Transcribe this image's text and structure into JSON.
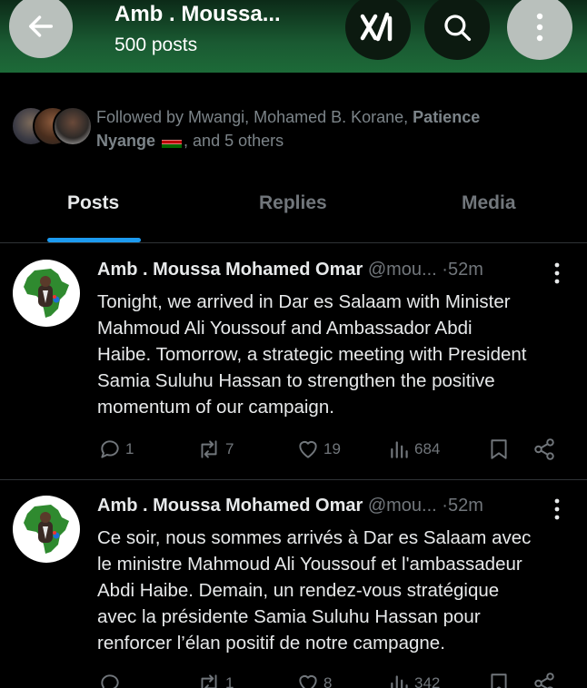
{
  "header": {
    "title": "Amb . Moussa...",
    "posts_count": "500 posts"
  },
  "followers": {
    "prefix": "Followed by Mwangi, Mohamed B. Korane, ",
    "highlight_line1": "Patience",
    "highlight_line2": "Nyange",
    "suffix": ", and 5 others"
  },
  "tabs": [
    {
      "label": "Posts",
      "active": true
    },
    {
      "label": "Replies",
      "active": false
    },
    {
      "label": "Media",
      "active": false
    }
  ],
  "accent_color": "#1d9bf0",
  "posts": [
    {
      "name": "Amb . Moussa Mohamed Omar",
      "handle": "@mou...",
      "time": "·52m",
      "lines": [
        "Tonight, we arrived in Dar es Salaam with Minister",
        "Mahmoud Ali Youssouf and Ambassador Abdi",
        "Haibe. Tomorrow, a strategic meeting with President",
        "Samia Suluhu Hassan to strengthen the positive",
        "momentum of our campaign."
      ],
      "replies": "1",
      "reposts": "7",
      "likes": "19",
      "views": "684"
    },
    {
      "name": "Amb . Moussa Mohamed Omar",
      "handle": "@mou...",
      "time": "·52m",
      "lines": [
        "Ce soir, nous sommes arrivés à Dar es Salaam avec",
        "le ministre Mahmoud Ali Youssouf et l'ambassadeur",
        "Abdi Haibe. Demain, un rendez-vous stratégique",
        "avec la présidente Samia Suluhu Hassan pour",
        "renforcer l’élan positif de notre campagne."
      ],
      "replies": "",
      "reposts": "1",
      "likes": "8",
      "views": "342"
    }
  ]
}
